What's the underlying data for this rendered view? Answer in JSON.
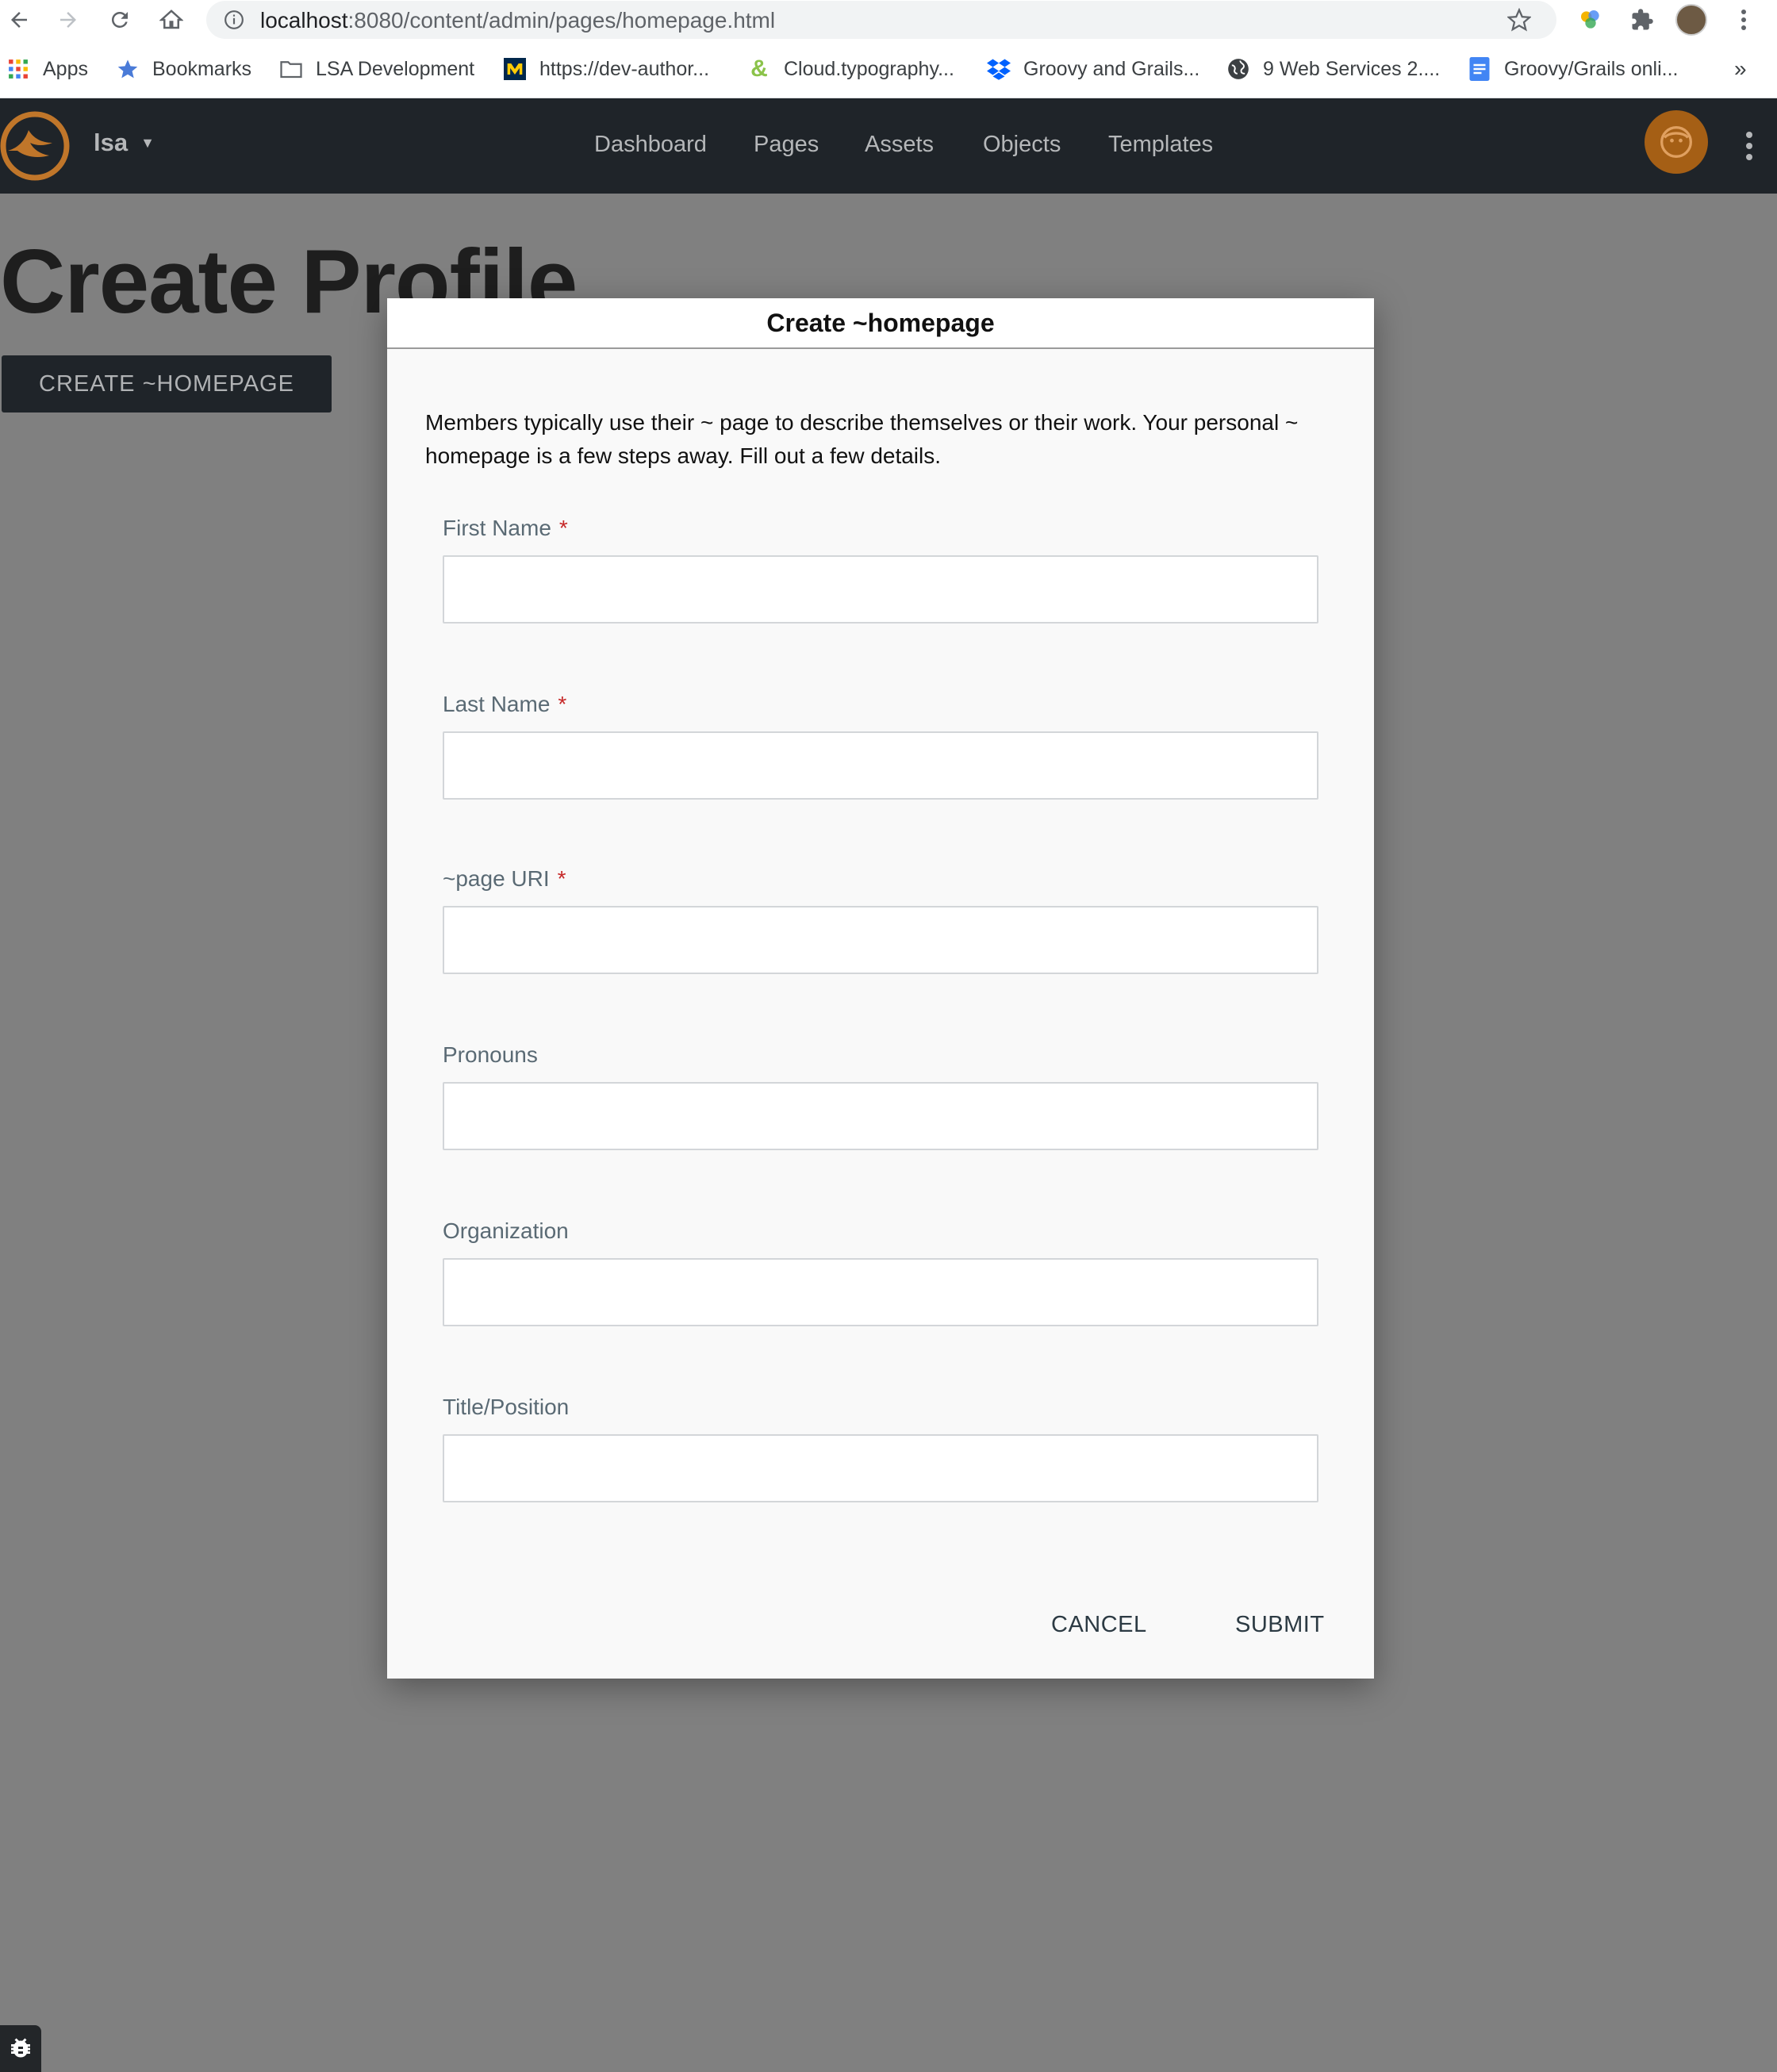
{
  "browser": {
    "url_host": "localhost",
    "url_path": ":8080/content/admin/pages/homepage.html",
    "bookmarks": [
      {
        "label": "Apps",
        "icon": "apps-grid-icon"
      },
      {
        "label": "Bookmarks",
        "icon": "star-icon"
      },
      {
        "label": "LSA Development",
        "icon": "folder-icon"
      },
      {
        "label": "https://dev-author...",
        "icon": "michigan-m-icon"
      },
      {
        "label": "Cloud.typography...",
        "icon": "ampersand-icon"
      },
      {
        "label": "Groovy and Grails...",
        "icon": "dropbox-icon"
      },
      {
        "label": "9 Web Services 2....",
        "icon": "globe-icon"
      },
      {
        "label": "Groovy/Grails onli...",
        "icon": "doc-icon"
      }
    ],
    "overflow": "»"
  },
  "navbar": {
    "site": "lsa",
    "site_caret": "▼",
    "links": [
      "Dashboard",
      "Pages",
      "Assets",
      "Objects",
      "Templates"
    ],
    "accent_color": "#a55f15"
  },
  "page": {
    "title": "Create Profile",
    "create_button": "CREATE ~HOMEPAGE"
  },
  "modal": {
    "title": "Create ~homepage",
    "description": "Members typically use their ~ page to describe themselves or their work. Your personal ~ homepage is a few steps away. Fill out a few details.",
    "fields": [
      {
        "label": "First Name",
        "required": "*",
        "value": ""
      },
      {
        "label": "Last Name",
        "required": "*",
        "value": ""
      },
      {
        "label": "~page URI",
        "required": "*",
        "value": ""
      },
      {
        "label": "Pronouns",
        "required": "",
        "value": ""
      },
      {
        "label": "Organization",
        "required": "",
        "value": ""
      },
      {
        "label": "Title/Position",
        "required": "",
        "value": ""
      }
    ],
    "cancel": "CANCEL",
    "submit": "SUBMIT"
  }
}
